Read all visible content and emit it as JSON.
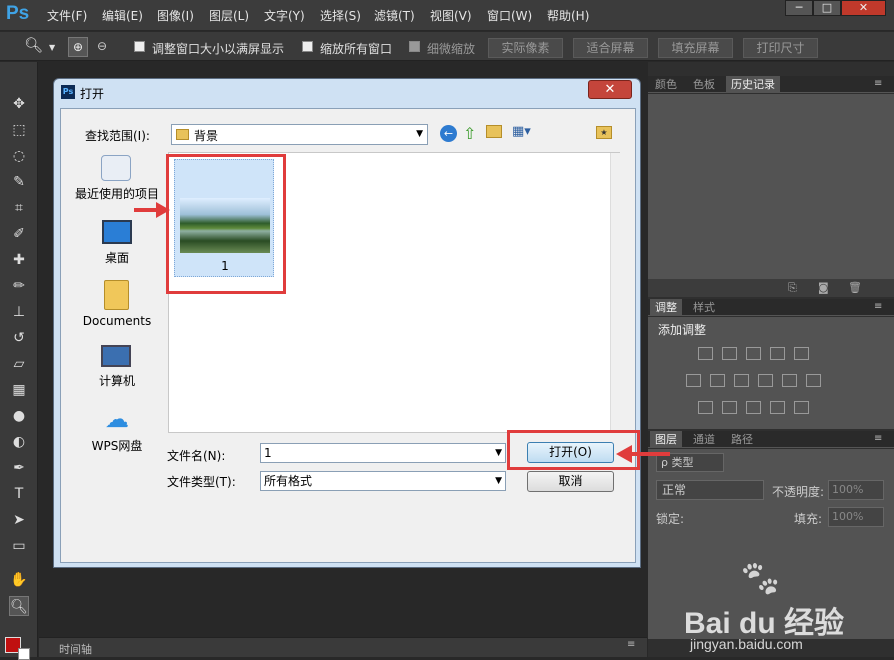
{
  "app": {
    "logo": "Ps",
    "menu": [
      "文件(F)",
      "编辑(E)",
      "图像(I)",
      "图层(L)",
      "文字(Y)",
      "选择(S)",
      "滤镜(T)",
      "视图(V)",
      "窗口(W)",
      "帮助(H)"
    ],
    "window_controls": [
      "─",
      "□",
      "✕"
    ]
  },
  "options_bar": {
    "resize_windows_label": "调整窗口大小以满屏显示",
    "zoom_all_windows_label": "缩放所有窗口",
    "scrubby_zoom_label": "细微缩放",
    "actual_pixels": "实际像素",
    "fit_screen": "适合屏幕",
    "fill_screen": "填充屏幕",
    "print_size": "打印尺寸"
  },
  "right_panel": {
    "top_tabs": [
      "颜色",
      "色板",
      "历史记录"
    ],
    "adjust_tabs": [
      "调整",
      "样式"
    ],
    "add_adjustment": "添加调整",
    "layers_tabs": [
      "图层",
      "通道",
      "路径"
    ],
    "kind_filter": "ρ 类型",
    "blend_mode": "正常",
    "opacity_label": "不透明度:",
    "opacity_value": "100%",
    "lock_label": "锁定:",
    "fill_label": "填充:",
    "fill_value": "100%"
  },
  "timeline": {
    "label": "时间轴"
  },
  "dialog": {
    "title": "打开",
    "close": "✕",
    "look_in_label": "查找范围(I):",
    "look_in_value": "背景",
    "places": [
      "最近使用的项目",
      "桌面",
      "Documents",
      "计算机",
      "WPS网盘"
    ],
    "file_name": "1",
    "file_name_label": "文件名(N):",
    "file_name_value": "1",
    "file_type_label": "文件类型(T):",
    "file_type_value": "所有格式",
    "open_button": "打开(O)",
    "cancel_button": "取消"
  },
  "watermark": {
    "brand": "Bai du 经验",
    "url": "jingyan.baidu.com"
  },
  "colors": {
    "annotation_red": "#e03c3c",
    "ps_blue": "#3fa3e6"
  }
}
